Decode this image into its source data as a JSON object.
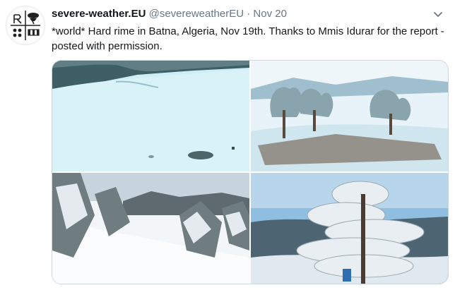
{
  "tweet": {
    "display_name": "severe-weather.EU",
    "handle": "@severeweatherEU",
    "separator": "·",
    "date": "Nov 20",
    "text": "*world* Hard rime in Batna, Algeria, Nov 19th. Thanks to Mmis Idurar for the report - posted with permission."
  },
  "icons": {
    "avatar": "severe-weather-logo-icon",
    "more": "chevron-down-icon"
  },
  "colors": {
    "name": "#14171a",
    "secondary": "#657786",
    "snow": "#dff3f7",
    "sky": "#a9d0e6"
  }
}
